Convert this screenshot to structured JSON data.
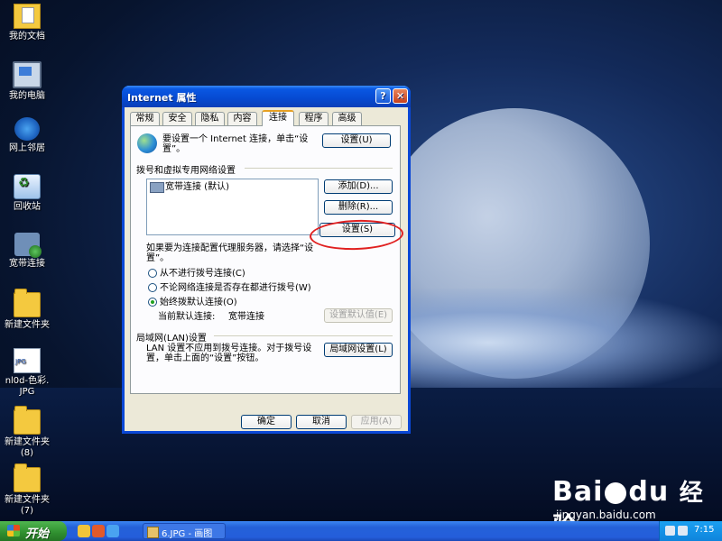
{
  "desktop": {
    "icons": [
      {
        "label": "我的文档"
      },
      {
        "label": "我的电脑"
      },
      {
        "label": "网上邻居"
      },
      {
        "label": "回收站"
      },
      {
        "label": "宽带连接"
      },
      {
        "label": "新建文件夹"
      },
      {
        "label": "nl0d-色彩.",
        "label2": "JPG"
      },
      {
        "label": "新建文件夹",
        "label2": "(8)"
      },
      {
        "label": "新建文件夹",
        "label2": "(7)"
      }
    ]
  },
  "dialog": {
    "title": "Internet 属性",
    "title_buttons": {
      "help": "?",
      "close": "✕"
    },
    "tabs": [
      "常规",
      "安全",
      "隐私",
      "内容",
      "连接",
      "程序",
      "高级"
    ],
    "active_tab": "连接",
    "setup": {
      "text": "要设置一个 Internet 连接，单击“设",
      "text2": "置”。",
      "button": "设置(U)"
    },
    "dialup_group": "拨号和虚拟专用网络设置",
    "connections": [
      {
        "name": "宽带连接 (默认)"
      }
    ],
    "buttons": {
      "add": "添加(D)...",
      "remove": "删除(R)...",
      "settings": "设置(S)"
    },
    "proxy_text": "如果要为连接配置代理服务器，请选择“设",
    "proxy_text2": "置”。",
    "radios": [
      {
        "label": "从不进行拨号连接(C)",
        "checked": false
      },
      {
        "label": "不论网络连接是否存在都进行拨号(W)",
        "checked": false
      },
      {
        "label": "始终拨默认连接(O)",
        "checked": true
      }
    ],
    "current_default_label": "当前默认连接:",
    "current_default_value": "宽带连接",
    "set_default_button": "设置默认值(E)",
    "lan_group": "局域网(LAN)设置",
    "lan_text": "LAN 设置不应用到拨号连接。对于拨号设",
    "lan_text2": "置，单击上面的“设置”按钮。",
    "lan_button": "局域网设置(L)",
    "footer": {
      "ok": "确定",
      "cancel": "取消",
      "apply": "应用(A)"
    }
  },
  "taskbar": {
    "start": "开始",
    "task_label": "6.JPG - 画图",
    "clock": "7:15"
  },
  "watermark": {
    "brand": "Bai",
    "brand2": "du",
    "cn": "经验",
    "url": "jingyan.baidu.com"
  }
}
